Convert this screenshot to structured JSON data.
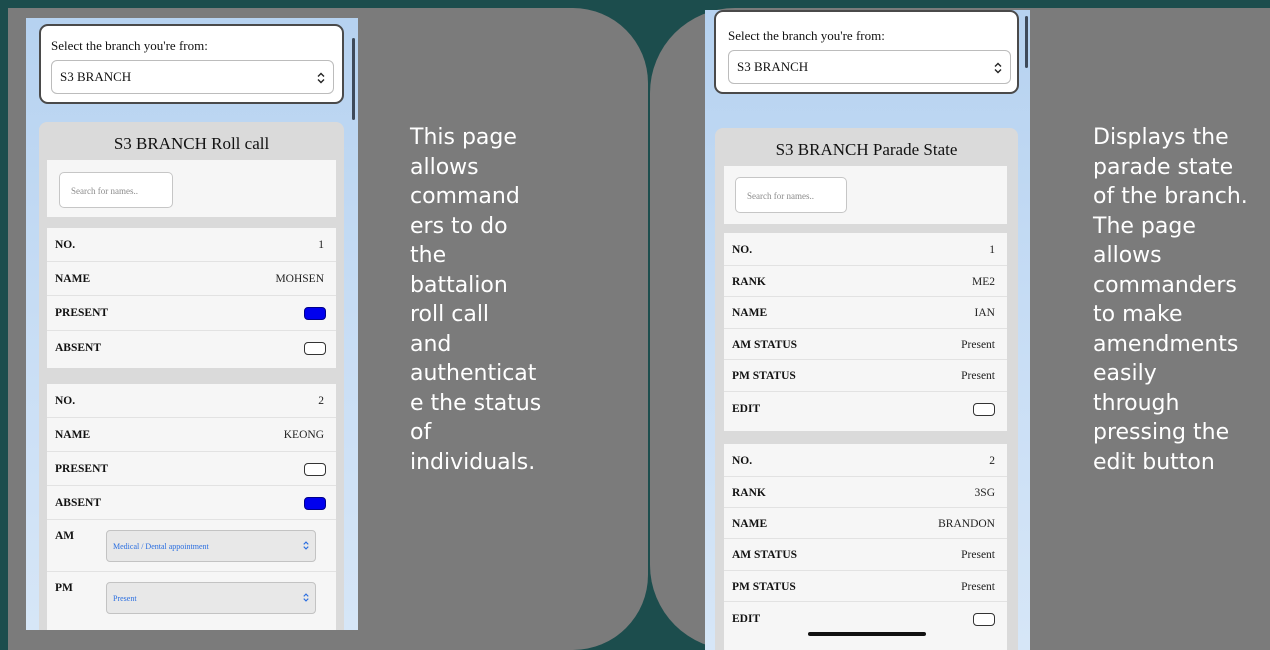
{
  "left_phone": {
    "branch_select_label": "Select the branch you're from:",
    "branch_value": "S3 BRANCH",
    "panel_title": "S3 BRANCH Roll call",
    "search_placeholder": "Search for names..",
    "records": [
      {
        "no_key": "NO.",
        "no_val": "1",
        "name_key": "NAME",
        "name_val": "MOHSEN",
        "present_key": "PRESENT",
        "present_checked": true,
        "absent_key": "ABSENT",
        "absent_checked": false
      },
      {
        "no_key": "NO.",
        "no_val": "2",
        "name_key": "NAME",
        "name_val": "KEONG",
        "present_key": "PRESENT",
        "present_checked": false,
        "absent_key": "ABSENT",
        "absent_checked": true,
        "am_key": "AM",
        "am_value": "Medical / Dental appointment",
        "pm_key": "PM",
        "pm_value": "Present"
      }
    ]
  },
  "left_caption": "This page\nallows\ncommand\ners to do\nthe\nbattalion\nroll call\nand\nauthenticat\ne the status\nof\nindividuals.",
  "right_phone": {
    "branch_select_label": "Select the branch you're from:",
    "branch_value": "S3 BRANCH",
    "panel_title": "S3 BRANCH Parade State",
    "search_placeholder": "Search for names..",
    "records": [
      {
        "no_key": "NO.",
        "no_val": "1",
        "rank_key": "RANK",
        "rank_val": "ME2",
        "name_key": "NAME",
        "name_val": "IAN",
        "am_key": "AM STATUS",
        "am_val": "Present",
        "pm_key": "PM STATUS",
        "pm_val": "Present",
        "edit_key": "EDIT"
      },
      {
        "no_key": "NO.",
        "no_val": "2",
        "rank_key": "RANK",
        "rank_val": "3SG",
        "name_key": "NAME",
        "name_val": "BRANDON",
        "am_key": "AM STATUS",
        "am_val": "Present",
        "pm_key": "PM STATUS",
        "pm_val": "Present",
        "edit_key": "EDIT"
      }
    ]
  },
  "right_caption": "Displays the\nparade state\nof the branch.\nThe page\nallows\ncommanders\nto make\namendments\neasily\nthrough\npressing the\nedit button",
  "colors": {
    "background": "#1c4d4d",
    "slide": "#7b7b7b",
    "toggle_on": "#0000ee",
    "select_accent": "#2a6ee0"
  }
}
